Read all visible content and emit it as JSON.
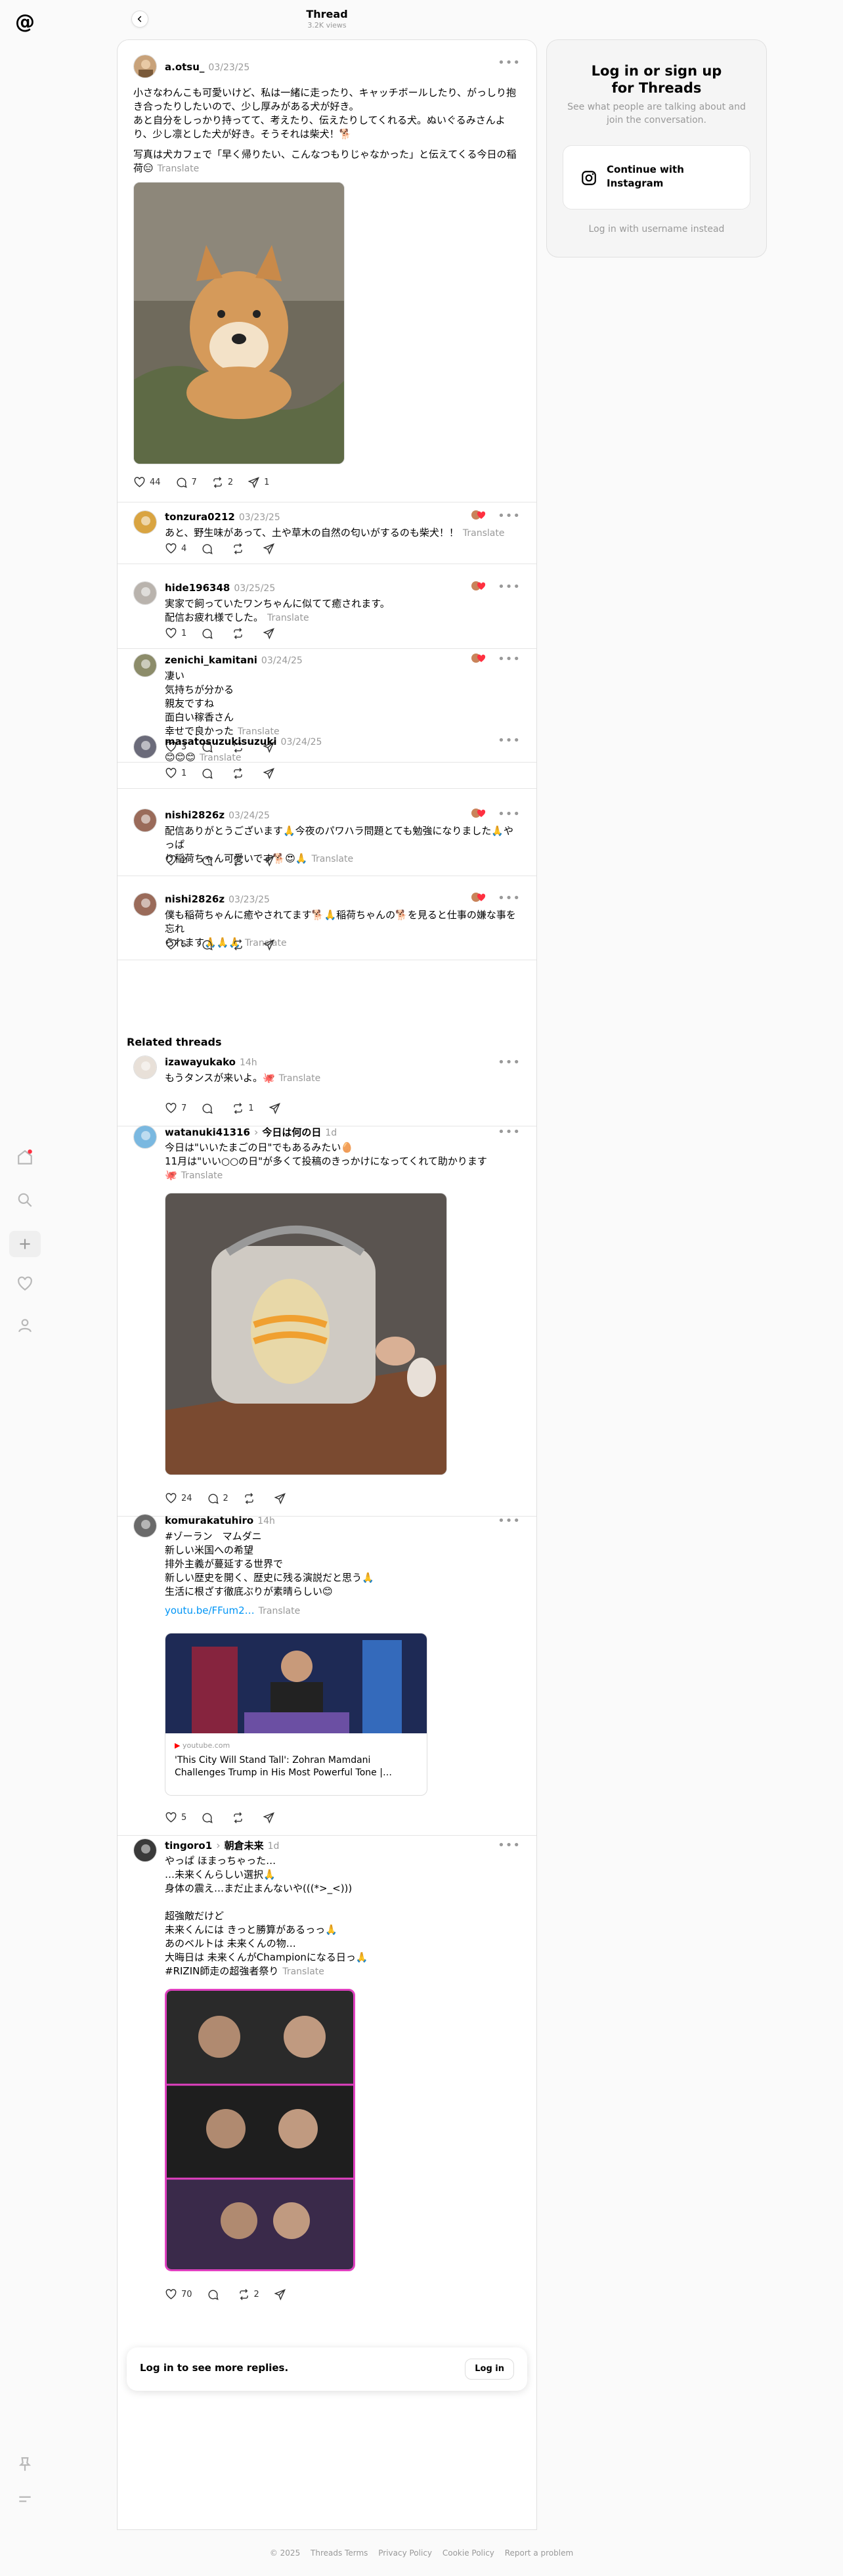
{
  "header": {
    "title": "Thread",
    "views": "3.2K views"
  },
  "main_post": {
    "username": "a.otsu_",
    "date": "03/23/25",
    "lines": [
      "小さなわんこも可愛いけど、私は一緒に走ったり、キャッチボールしたり、がっしり抱",
      "き合ったりしたいので、少し厚みがある犬が好き。",
      "あと自分をしっかり持ってて、考えたり、伝えたりしてくれる犬。ぬいぐるみさんよ",
      "り、少し凛とした犬が好き。そうそれは柴犬！🐕"
    ],
    "lines2": [
      "写真は犬カフェで「早く帰りたい、こんなつもりじゃなかった」と伝えてくる今日の稲",
      "荷😑"
    ],
    "translate": "Translate",
    "likes": "44",
    "replies": "7",
    "reposts": "2",
    "shares": "1"
  },
  "replies": [
    {
      "username": "tonzura0212",
      "date": "03/23/25",
      "lines": [
        "あと、野生味があって、土や草木の自然の匂いがするのも柴犬！！"
      ],
      "likes": "4"
    },
    {
      "username": "hide196348",
      "date": "03/25/25",
      "lines": [
        "実家で飼っていたワンちゃんに似てて癒されます。",
        "配信お疲れ様でした。"
      ],
      "likes": "1"
    },
    {
      "username": "zenichi_kamitani",
      "date": "03/24/25",
      "lines": [
        "凄い",
        "気持ちが分かる",
        "親友ですね",
        "面白い稼香さん",
        "幸せで良かった"
      ],
      "likes": "3"
    },
    {
      "username": "masatosuzukisuzuki",
      "date": "03/24/25",
      "lines": [
        "😊😊😊"
      ],
      "likes": "1"
    },
    {
      "username": "nishi2826z",
      "date": "03/24/25",
      "lines": [
        "配信ありがとうございます🙏今夜のパワハラ問題とても勉強になりました🙏やっぱ",
        "り稲荷ちゃん可愛いです🐕😍🙏"
      ],
      "likes": "2"
    },
    {
      "username": "nishi2826z",
      "date": "03/23/25",
      "lines": [
        "僕も稲荷ちゃんに癒やされてます🐕🙏稲荷ちゃんの🐕を見ると仕事の嫌な事を忘れ",
        "られます🙏🙏🙏"
      ],
      "likes": "5"
    }
  ],
  "related_title": "Related threads",
  "related": [
    {
      "username": "izawayukako",
      "date": "14h",
      "lines": [
        "もうタンスが来いよ。🐙"
      ],
      "likes": "7",
      "replies": "",
      "reposts": "1"
    },
    {
      "username": "watanuki41316",
      "topic": "今日は何の日",
      "date": "1d",
      "lines": [
        "今日は\"いいたまごの日\"でもあるみたい🥚",
        "11月は\"いい○○の日\"が多くて投稿のきっかけになってくれて助かります",
        "🐙"
      ],
      "likes": "24",
      "replies": "2",
      "reposts": ""
    },
    {
      "username": "komurakatuhiro",
      "date": "14h",
      "lines": [
        "#ゾーラン　マムダニ",
        "新しい米国への希望",
        "排外主義が蔓延する世界で",
        "新しい歴史を開く、歴史に残る演説だと思う🙏",
        "生活に根ざす徹底ぶりが素晴らしい😊"
      ],
      "link": "youtu.be/FFum2…",
      "card_source": "youtube.com",
      "card_title": "'This City Will Stand Tall': Zohran Mamdani Challenges Trump in His Most Powerful Tone |…",
      "likes": "5",
      "replies": "",
      "reposts": ""
    },
    {
      "username": "tingoro1",
      "topic": "朝倉未来",
      "date": "1d",
      "lines": [
        "やっぱ ほまっちゃった…",
        "…未来くんらしい選択🙏",
        "身体の震え…まだ止まんないや(((*>_<)))",
        "",
        "超強敵だけど",
        "未来くんには きっと勝算があるっっ🙏",
        "あのベルトは 未来くんの物…",
        "大晦日は 未来くんがChampionになる日っ🙏",
        "#RIZIN師走の超強者祭り"
      ],
      "likes": "70",
      "replies": "",
      "reposts": "2"
    }
  ],
  "translate_label": "Translate",
  "login_replies": {
    "text": "Log in to see more replies.",
    "button": "Log in"
  },
  "login_box": {
    "title": "Log in or sign up for Threads",
    "subtitle": "See what people are talking about and join the conversation.",
    "button": "Continue with Instagram",
    "link": "Log in with username instead"
  },
  "footer": [
    "© 2025",
    "Threads Terms",
    "Privacy Policy",
    "Cookie Policy",
    "Report a problem"
  ],
  "colors": {
    "accent_red": "#ff3040",
    "link_blue": "#0095f6"
  }
}
